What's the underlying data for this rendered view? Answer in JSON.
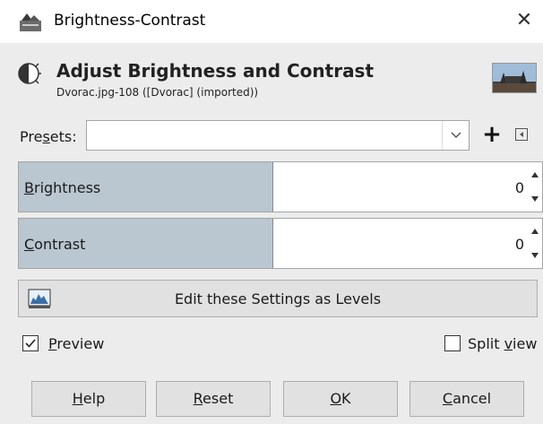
{
  "window": {
    "title": "Brightness-Contrast",
    "close_glyph": "✕"
  },
  "header": {
    "title": "Adjust Brightness and Contrast",
    "subtitle": "Dvorac.jpg-108 ([Dvorac] (imported))",
    "icon": "brightness-contrast-icon"
  },
  "presets": {
    "label_pre": "Pre",
    "label_mnemonic": "s",
    "label_post": "ets:",
    "value": "",
    "add_glyph": "+"
  },
  "brightness": {
    "label_mnemonic": "B",
    "label_rest": "rightness",
    "value": "0"
  },
  "contrast": {
    "label_mnemonic": "C",
    "label_rest": "ontrast",
    "value": "0"
  },
  "levels_button": {
    "label": "Edit these Settings as Levels",
    "icon": "levels-icon"
  },
  "preview": {
    "label_mnemonic": "P",
    "label_rest": "review",
    "checked": true
  },
  "split_view": {
    "label_pre": "Split ",
    "label_mnemonic": "v",
    "label_post": "iew",
    "checked": false
  },
  "buttons": {
    "help": {
      "mnemonic": "H",
      "rest": "elp"
    },
    "reset": {
      "mnemonic": "R",
      "rest": "eset"
    },
    "ok": {
      "mnemonic": "O",
      "rest": "K"
    },
    "cancel": {
      "mnemonic": "C",
      "rest": "ancel"
    }
  },
  "colors": {
    "dialog_bg": "#ececec",
    "slider_fill": "#bac6d0",
    "button_bg": "#e1e1e1"
  }
}
